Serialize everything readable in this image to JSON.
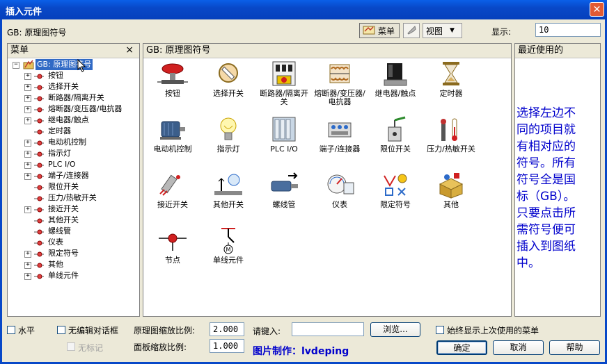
{
  "window": {
    "title": "插入元件"
  },
  "library": {
    "label": "GB: 原理图符号"
  },
  "toolbar": {
    "menu_label": "菜单",
    "view_label": "视图",
    "display_label": "显示:",
    "display_value": "10"
  },
  "menu_pane": {
    "title": "菜单",
    "close": "×"
  },
  "tree": {
    "root": "GB: 原理图符号",
    "items": [
      {
        "label": "按钮",
        "expandable": true
      },
      {
        "label": "选择开关",
        "expandable": true
      },
      {
        "label": "断路器/隔离开关",
        "expandable": true
      },
      {
        "label": "熔断器/变压器/电抗器",
        "expandable": true
      },
      {
        "label": "继电器/触点",
        "expandable": true
      },
      {
        "label": "定时器",
        "expandable": false
      },
      {
        "label": "电动机控制",
        "expandable": true
      },
      {
        "label": "指示灯",
        "expandable": true
      },
      {
        "label": "PLC I/O",
        "expandable": true
      },
      {
        "label": "端子/连接器",
        "expandable": true
      },
      {
        "label": "限位开关",
        "expandable": false
      },
      {
        "label": "压力/热敏开关",
        "expandable": false
      },
      {
        "label": "接近开关",
        "expandable": true
      },
      {
        "label": "其他开关",
        "expandable": false
      },
      {
        "label": "螺线管",
        "expandable": false
      },
      {
        "label": "仪表",
        "expandable": false
      },
      {
        "label": "限定符号",
        "expandable": true
      },
      {
        "label": "其他",
        "expandable": true
      },
      {
        "label": "单线元件",
        "expandable": true
      }
    ]
  },
  "symbols_pane": {
    "title": "GB: 原理图符号",
    "items": [
      {
        "label": "按钮",
        "icon": "pushbutton-icon"
      },
      {
        "label": "选择开关",
        "icon": "selector-switch-icon"
      },
      {
        "label": "断路器/隔离开关",
        "icon": "breaker-icon"
      },
      {
        "label": "熔断器/变压器/电抗器",
        "icon": "transformer-icon"
      },
      {
        "label": "继电器/触点",
        "icon": "relay-icon"
      },
      {
        "label": "定时器",
        "icon": "hourglass-icon"
      },
      {
        "label": "电动机控制",
        "icon": "motor-icon"
      },
      {
        "label": "指示灯",
        "icon": "lamp-icon"
      },
      {
        "label": "PLC I/O",
        "icon": "plc-icon"
      },
      {
        "label": "端子/连接器",
        "icon": "terminal-icon"
      },
      {
        "label": "限位开关",
        "icon": "limit-switch-icon"
      },
      {
        "label": "压力/热敏开关",
        "icon": "pressure-switch-icon"
      },
      {
        "label": "接近开关",
        "icon": "proximity-switch-icon"
      },
      {
        "label": "其他开关",
        "icon": "other-switch-icon"
      },
      {
        "label": "螺线管",
        "icon": "solenoid-icon"
      },
      {
        "label": "仪表",
        "icon": "meter-icon"
      },
      {
        "label": "限定符号",
        "icon": "qualifier-icon"
      },
      {
        "label": "其他",
        "icon": "other-box-icon"
      },
      {
        "label": "节点",
        "icon": "node-icon"
      },
      {
        "label": "单线元件",
        "icon": "single-line-icon"
      }
    ]
  },
  "recent_pane": {
    "title": "最近使用的",
    "note_lines": [
      "选择左边不",
      "同的项目就",
      "有相对应的",
      "符号。所有",
      "符号全是国",
      "标（GB）。",
      "只要点击所",
      "需符号便可",
      "插入到图纸",
      "中。"
    ]
  },
  "bottom": {
    "horizontal_label": "水平",
    "no_edit_dialog_label": "无编辑对话框",
    "no_tag_label": "无标记",
    "schematic_scale_label": "原理图缩放比例:",
    "schematic_scale_value": "2.000",
    "panel_scale_label": "面板缩放比例:",
    "panel_scale_value": "1.000",
    "type_in_label": "请键入:",
    "type_in_value": "",
    "browse_label": "浏览...",
    "always_show_label": "始终显示上次使用的菜单",
    "ok_label": "确定",
    "cancel_label": "取消",
    "help_label": "帮助",
    "credit": "图片制作：lvdeping"
  }
}
